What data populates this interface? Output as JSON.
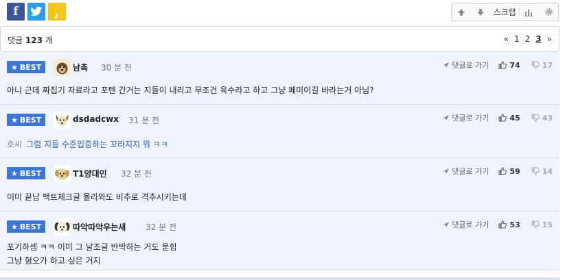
{
  "share": {
    "facebook_glyph": "f",
    "twitter_glyph": "t",
    "kakao_glyph": ","
  },
  "tools": {
    "scrap_label": "스크랩"
  },
  "comment_bar": {
    "label_prefix": "댓글",
    "count": "123",
    "label_suffix": "개",
    "pages": {
      "prev": "«",
      "p1": "1",
      "p2": "2",
      "p3": "3",
      "next": "»"
    }
  },
  "best_label": "BEST",
  "goto_label": "댓글로 가기",
  "comments": [
    {
      "nickname": "남촉",
      "time": "30 분 전",
      "likes": "74",
      "dislikes": "17",
      "body": "아니 근데 짜집기 자료라고 포텐 간거는 지들이 내리고 무조건 육수라고 하고 그냥 페미이길 바라는거 아님?"
    },
    {
      "nickname": "dsdadcwx",
      "time": "31 분 전",
      "likes": "45",
      "dislikes": "43",
      "body_prefix": "호씨",
      "body": "그럼 지들 수준입증하는 꼬라지지 뭐 ㅋㅋ"
    },
    {
      "nickname": "T1양대인",
      "time": "32 분 전",
      "likes": "59",
      "dislikes": "14",
      "body": "이미 끝남 팩트체크글 올라와도 비추로 격추시키는데"
    },
    {
      "nickname": "따악따악우는새",
      "time": "32 분 전",
      "likes": "53",
      "dislikes": "15",
      "body_line1": "포기하셈 ㅋㅋ 이미 그 날조글 반박하는 거도 묻힘",
      "body_line2": "그냥 혐오가 하고 싶은 거지"
    }
  ],
  "colors": {
    "accent": "#3d76d6",
    "row_bg": "#eef3fc",
    "link": "#2a62c2"
  }
}
